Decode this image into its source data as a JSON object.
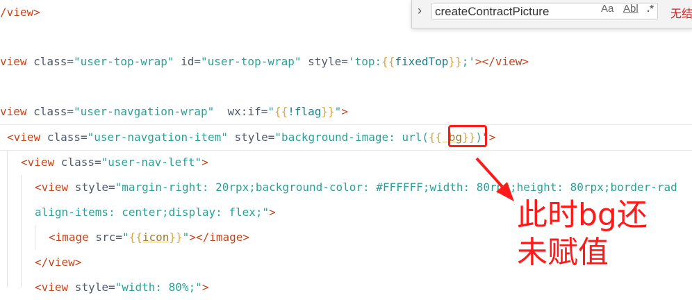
{
  "code": {
    "l1": {
      "close": "/view>"
    },
    "l2": {
      "tag": "view",
      "a1": " class=",
      "v1": "\"user-top-wrap\"",
      "a2": " id=",
      "v2": "\"user-top-wrap\"",
      "a3": " style=",
      "v3a": "'top:",
      "v3b": "{{",
      "v3c": "fixedTop",
      "v3d": "}}",
      "v3e": ";'",
      "end": "></view>"
    },
    "l3": {
      "tag": "view",
      "a1": " class=",
      "v1": "\"user-navgation-wrap\"",
      "a2": "  wx:if=",
      "v2a": "\"",
      "v2b": "{{",
      "v2c": "!flag",
      "v2d": "}}",
      "v2e": "\"",
      "end": ">"
    },
    "l4": {
      "open": "<view",
      "a1": " class=",
      "v1": "\"user-navgation-item\"",
      "a2": " style=",
      "v2a": "\"background-image: url(",
      "v2b": "{{",
      "v2c": " bg",
      "v2d": "}}",
      "v2e": ")\"",
      "end": ">"
    },
    "l5": {
      "open": "<view",
      "a1": " class=",
      "v1": "\"user-nav-left\"",
      "end": ">"
    },
    "l6": {
      "open": "<view",
      "a1": " style=",
      "v1": "\"margin-right: 20rpx;background-color: #FFFFFF;width: 80rpx;height: 80rpx;border-rad"
    },
    "l7": {
      "text": "align-items: center;display: flex;\"",
      "end": ">"
    },
    "l8": {
      "open": "<image",
      "a1": " src=",
      "v1a": "\"",
      "v1b": "{{",
      "v1c": "icon",
      "v1d": "}}",
      "v1e": "\"",
      "end": "></image>"
    },
    "l9": {
      "close": "</view>"
    },
    "l10": {
      "open": "<view",
      "a1": " style=",
      "v1": "\"width: 80%;\"",
      "end": ">"
    }
  },
  "find": {
    "query": "createContractPicture",
    "match_case": "Aa",
    "whole_word": "Abl",
    "regex": ".*",
    "result": "无结"
  },
  "annotation": {
    "line1": "此时bg还",
    "line2": "未赋值"
  }
}
